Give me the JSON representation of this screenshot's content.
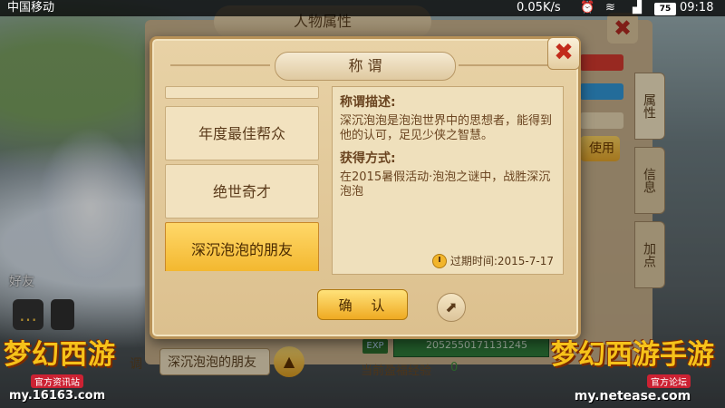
{
  "status_bar": {
    "carrier": "中国移动",
    "speed": "0.05K/s",
    "battery": "75",
    "time": "09:18"
  },
  "background": {
    "panel_title": "人物属性",
    "close_glyph": "✖",
    "use_label": "使用",
    "side_tabs": [
      "属性",
      "信息",
      "加点"
    ],
    "friend_label": "好友",
    "title_label": "调",
    "current_title": "深沉泡泡的朋友",
    "exp_badge": "EXP",
    "exp_value": "2052550171131245",
    "fortune_label": "当前盈福经验",
    "fortune_value": "0"
  },
  "modal": {
    "title": "称 谓",
    "close_glyph": "✖",
    "list_items": [
      "年度最佳帮众",
      "绝世奇才",
      "深沉泡泡的朋友"
    ],
    "selected_index": 2,
    "description_heading": "称谓描述:",
    "description_text": "深沉泡泡是泡泡世界中的思想者，能得到他的认可，足见少侠之智慧。",
    "obtain_heading": "获得方式:",
    "obtain_text": "在2015暑假活动·泡泡之谜中，战胜深沉泡泡",
    "expiry_text": "过期时间:2015-7-17",
    "confirm_label": "确 认",
    "share_glyph": "⬈"
  },
  "logos": {
    "left_mark": "梦幻西游",
    "left_sub": "官方资讯站",
    "left_url": "my.16163.com",
    "right_mark": "梦幻西游手游",
    "right_sub": "官方论坛",
    "right_url": "my.netease.com"
  },
  "icons": {
    "clock": "clock-icon",
    "share": "share-icon",
    "close": "close-icon",
    "up_arrow": "up-arrow-icon",
    "chat": "chat-icon"
  }
}
